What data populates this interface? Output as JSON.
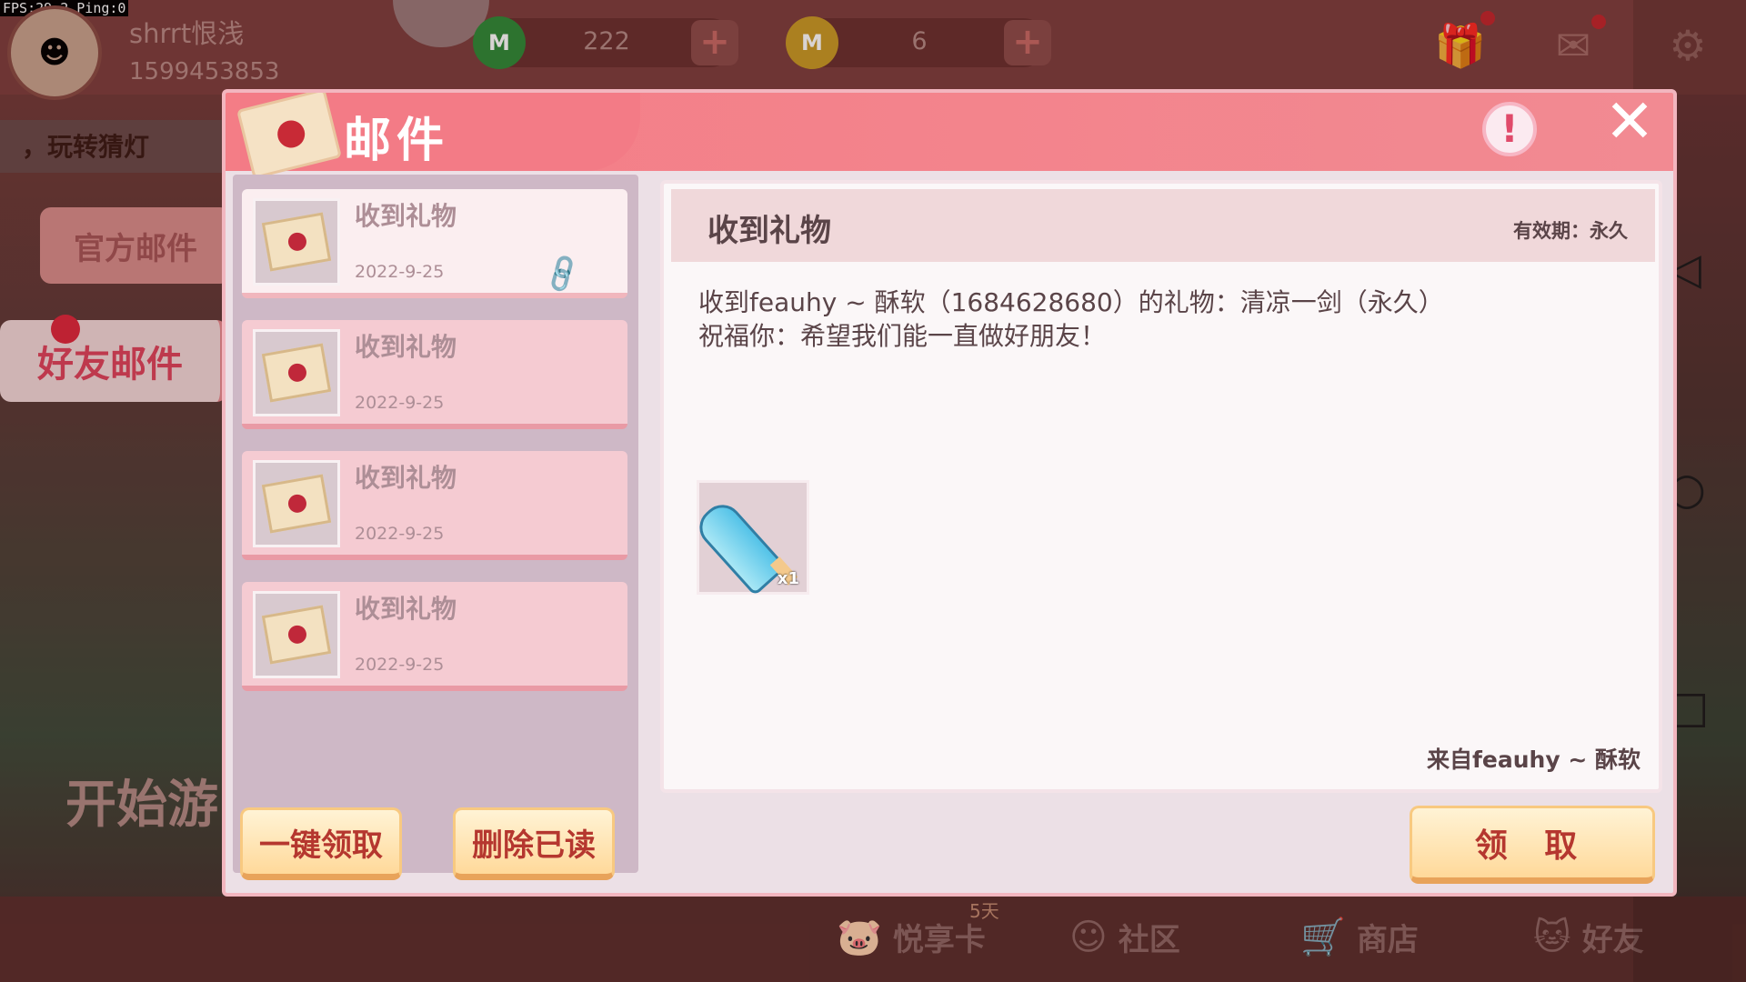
{
  "status": {
    "fps_label": "FPS:29.2  Ping:0"
  },
  "user": {
    "name": "shrrt恨浅",
    "id": "1599453853"
  },
  "currency": [
    {
      "value": "222",
      "icon": "green-coin-icon"
    },
    {
      "value": "6",
      "icon": "gold-coin-icon"
    }
  ],
  "marquee": {
    "text": "，玩转猜灯"
  },
  "side_tabs": {
    "official": "官方邮件",
    "friend": "好友邮件"
  },
  "background": {
    "start_game": "开始游"
  },
  "dialog": {
    "title": "邮件",
    "warn_symbol": "!",
    "close_symbol": "✕",
    "mails": [
      {
        "title": "收到礼物",
        "date": "2022-9-25"
      },
      {
        "title": "收到礼物",
        "date": "2022-9-25"
      },
      {
        "title": "收到礼物",
        "date": "2022-9-25"
      },
      {
        "title": "收到礼物",
        "date": "2022-9-25"
      }
    ],
    "buttons": {
      "claim_all": "一键领取",
      "delete_read": "删除已读",
      "claim": "领 取"
    },
    "detail": {
      "subject": "收到礼物",
      "validity": "有效期：永久",
      "body_line1": "收到feauhy ~ 酥软（1684628680）的礼物：清凉一剑（永久）",
      "body_line2": "祝福你：希望我们能一直做好朋友！",
      "item_qty": "x1",
      "from": "来自feauhy ~ 酥软"
    }
  },
  "bottom_nav": {
    "timer_badge": "5天",
    "yuexiangka": "悦享卡",
    "community": "社区",
    "shop": "商店",
    "friends": "好友"
  },
  "colors": {
    "header": "#f47d86",
    "button_text": "#b5372f",
    "friend_tab_text": "#e0445c"
  }
}
